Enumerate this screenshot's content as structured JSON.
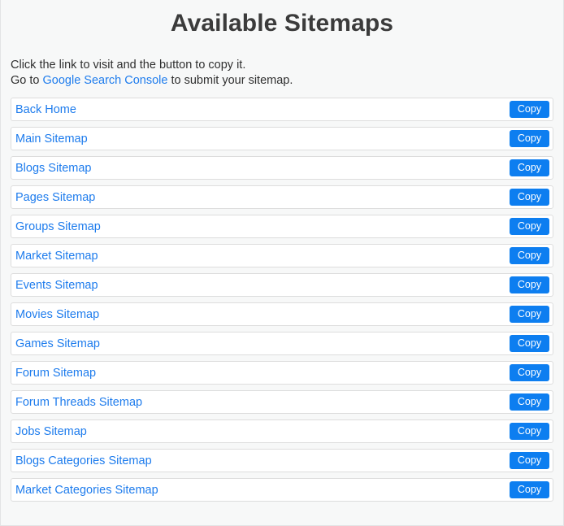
{
  "page": {
    "title": "Available Sitemaps",
    "background_color": "#f7f8f8",
    "title_color": "#3b3b3b",
    "link_color": "#1e7ced",
    "button_color": "#0d7ef0",
    "card_border_color": "#dddddd"
  },
  "intro": {
    "line1": "Click the link to visit and the button to copy it.",
    "line2_prefix": "Go to ",
    "line2_link": "Google Search Console",
    "line2_suffix": " to submit your sitemap."
  },
  "list": {
    "copy_label": "Copy",
    "items": [
      {
        "label": "Back Home",
        "copy_label": "Copy"
      },
      {
        "label": "Main Sitemap",
        "copy_label": "Copy"
      },
      {
        "label": "Blogs Sitemap",
        "copy_label": "Copy"
      },
      {
        "label": "Pages Sitemap",
        "copy_label": "Copy"
      },
      {
        "label": "Groups Sitemap",
        "copy_label": "Copy"
      },
      {
        "label": "Market Sitemap",
        "copy_label": "Copy"
      },
      {
        "label": "Events Sitemap",
        "copy_label": "Copy"
      },
      {
        "label": "Movies Sitemap",
        "copy_label": "Copy"
      },
      {
        "label": "Games Sitemap",
        "copy_label": "Copy"
      },
      {
        "label": "Forum Sitemap",
        "copy_label": "Copy"
      },
      {
        "label": "Forum Threads Sitemap",
        "copy_label": "Copy"
      },
      {
        "label": "Jobs Sitemap",
        "copy_label": "Copy"
      },
      {
        "label": "Blogs Categories Sitemap",
        "copy_label": "Copy"
      },
      {
        "label": "Market Categories Sitemap",
        "copy_label": "Copy"
      }
    ]
  }
}
